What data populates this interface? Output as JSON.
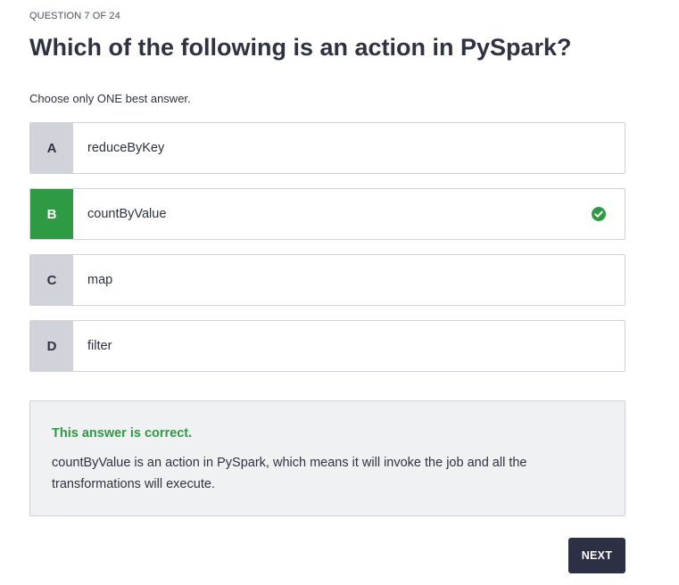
{
  "quiz": {
    "progress": "QUESTION 7 OF 24",
    "question": "Which of the following is an action in PySpark?",
    "instruction": "Choose only ONE best answer.",
    "options": [
      {
        "letter": "A",
        "text": "reduceByKey",
        "state": "default"
      },
      {
        "letter": "B",
        "text": "countByValue",
        "state": "correct",
        "icon": "check-circle-icon"
      },
      {
        "letter": "C",
        "text": "map",
        "state": "default"
      },
      {
        "letter": "D",
        "text": "filter",
        "state": "default"
      }
    ],
    "feedback": {
      "status": "This answer is correct.",
      "explanation": "countByValue is an action in PySpark, which means it will invoke the job and all the transformations will execute."
    },
    "next_label": "NEXT"
  },
  "colors": {
    "correct": "#2f9a44",
    "letter_bg": "#d0d3da",
    "text": "#2d3340",
    "button_bg": "#2d3044",
    "feedback_bg": "#f0f1f2"
  }
}
